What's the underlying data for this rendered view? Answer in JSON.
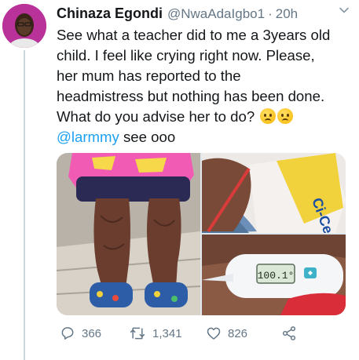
{
  "tweet": {
    "author": {
      "display_name": "Chinaza Egondi",
      "handle": "@NwaAdaIgbo1",
      "avatar_icon": "avatar-photo"
    },
    "separator": "·",
    "time": "20h",
    "text_lines": [
      "See what a teacher did to me a 3years old",
      "child. I feel like crying right now. Please,",
      "her mum has reported to the",
      "headmistress but nothing has been done.",
      "What do you advise her to do?"
    ],
    "emojis": [
      "worried-face-emoji",
      "worried-face-emoji"
    ],
    "mention": "@larmmy",
    "mention_suffix": " see ooo",
    "media": {
      "thermometer_reading": "100.1°"
    },
    "actions": {
      "reply_count": "366",
      "retweet_count": "1,341",
      "like_count": "826"
    }
  },
  "colors": {
    "text": "#14171a",
    "secondary": "#657786",
    "link": "#1da1f2",
    "divider": "#ccd6dd"
  }
}
